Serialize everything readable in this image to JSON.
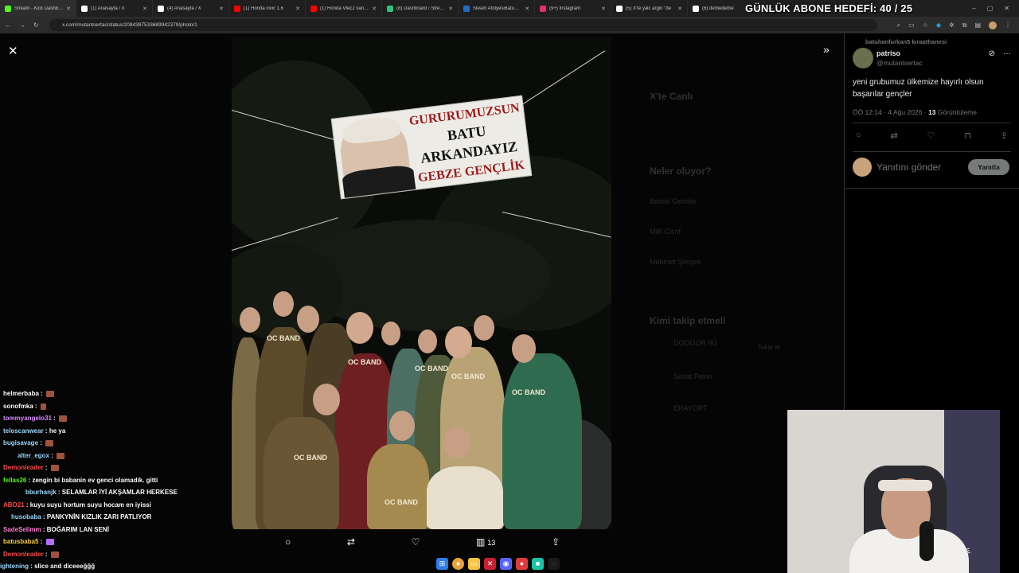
{
  "browser": {
    "tabs": [
      {
        "label": "Stream - Kick Dashboard",
        "color": "#53fc18"
      },
      {
        "label": "(1) Anasayfa / X",
        "color": "#ffffff"
      },
      {
        "label": "(4) Anasayfa / X",
        "color": "#ffffff"
      },
      {
        "label": "(1) Honda civic 1.6",
        "color": "#ff0000"
      },
      {
        "label": "(1) Honda Vtec2 vanes",
        "color": "#ff0000"
      },
      {
        "label": "(8) Dashboard / Stream",
        "color": "#2ec27e"
      },
      {
        "label": "Steam AtölyesiBatuhan",
        "color": "#1b6fc4"
      },
      {
        "label": "(9+) Instagram",
        "color": "#e1306c"
      },
      {
        "label": "(5) X'te yalc argin \"de",
        "color": "#ffffff"
      },
      {
        "label": "(6) derbederbe",
        "color": "#ffffff"
      }
    ],
    "new_tab": "+",
    "url": "x.com/mutantsertac/status/2084387533689942379/photo/1",
    "window_controls": [
      "–",
      "▢",
      "✕"
    ]
  },
  "overlay": {
    "goal_text": "GÜNLÜK ABONE HEDEFİ: 40 / 25"
  },
  "photo": {
    "banner_lines": [
      "GURURUMUZSUN",
      "BATU",
      "ARKANDAYIZ",
      "GEBZE GENÇLİK"
    ],
    "shirt_label": "OC BAND"
  },
  "photo_actions": {
    "views_count": "13"
  },
  "tweet": {
    "repost_line": "batuhanfurkan5 kıraathanesi",
    "display_name": "patriso",
    "handle": "@mutantsertac",
    "text_line1": "yeni grubumuz ülkemize hayırlı olsun",
    "text_line2": "başarılar gençler",
    "time": "ÖÖ 12:14 · 4 Ağu 2026 ·",
    "views_num": "13",
    "views_label": "Görüntüleme",
    "reply_placeholder": "Yanıtını gönder",
    "reply_button": "Yanıtla"
  },
  "background_ghost": {
    "live_title": "X'te Canlı",
    "trends_title": "Neler oluyor?",
    "trend1": "Bebek Gelinler",
    "trend2": "Millî Cisrif",
    "trend3": "Mehmet Şimşek",
    "follow_title": "Kimi takip etmeli",
    "follow1": "DOOOOR İKİ",
    "follow2": "Sedat Peker",
    "follow3": "ERAYORT",
    "follow_btn": "Takip et"
  },
  "chat": [
    {
      "user": "helmerbaba",
      "text": "",
      "color": "#ffffff",
      "emote": true
    },
    {
      "user": "sonofmka",
      "text": "",
      "color": "#ffffff",
      "emote": true
    },
    {
      "user": "tommyangelo31",
      "text": "",
      "color": "#d98cff",
      "emote": true
    },
    {
      "user": "teloscanwear",
      "text": "he ya",
      "color": "#9ad9ff",
      "emote": false
    },
    {
      "user": "bugisavage",
      "text": "",
      "color": "#9ad9ff",
      "emote": true
    },
    {
      "user": "alter_egox",
      "text": "",
      "color": "#9ad9ff",
      "emote": true
    },
    {
      "user": "Demonleader",
      "text": "",
      "color": "#ff4b4b",
      "emote": true
    },
    {
      "user": "fellas26",
      "text": "zengin bi babanin ev genci olamadik. gitti",
      "color": "#53fc18",
      "emote": false
    },
    {
      "user": "bburhanjk",
      "text": "SELAMLAR İYİ AKŞAMLAR HERKESE",
      "color": "#9ad9ff",
      "emote": false
    },
    {
      "user": "ABO21",
      "text": "kuyu suyu hortum suyu hocam en iyissi",
      "color": "#ff4b4b",
      "emote": false
    },
    {
      "user": "husobaba",
      "text": "PANKYNİN KIZLIK ZARI PATLIYOR",
      "color": "#9ad9ff",
      "emote": false
    },
    {
      "user": "SadeSelimm",
      "text": "BOĞARIM LAN SENİ",
      "color": "#ff7bd5",
      "emote": false
    },
    {
      "user": "batusbaba5",
      "text": "",
      "color": "#ffd23f",
      "emote": true
    },
    {
      "user": "Demonleader",
      "text": "",
      "color": "#ff4b4b",
      "emote": true
    },
    {
      "user": "ightening",
      "text": "slice and diceeeğğğ",
      "color": "#9ad9ff",
      "emote": false
    }
  ],
  "webcam": {
    "mic_brand": "RØDE"
  }
}
